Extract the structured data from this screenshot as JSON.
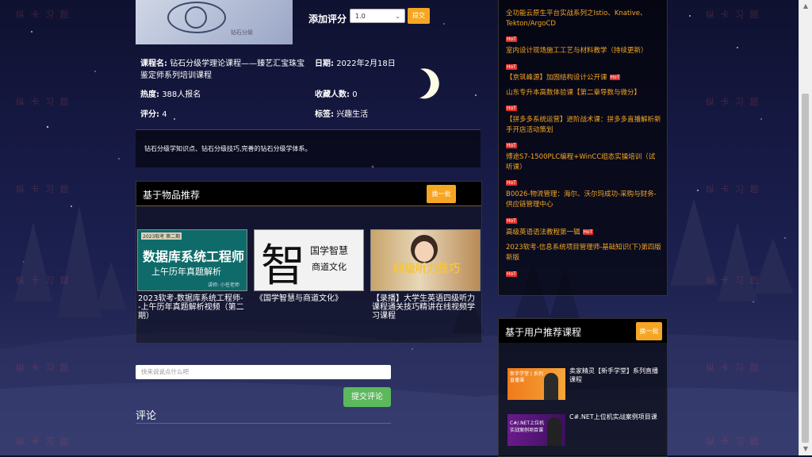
{
  "course": {
    "image_caption": "钻石分级",
    "rate_label": "添加评分",
    "rate_value": "1.0",
    "rate_submit": "提交",
    "name_label": "课程名:",
    "name_value": "钻石分级学理论课程——臻艺汇宝珠宝鉴定师系列培训课程",
    "date_label": "日期:",
    "date_value": "2022年2月18日",
    "heat_label": "热度:",
    "heat_value": "388人报名",
    "fav_label": "收藏人数:",
    "fav_value": "0",
    "score_label": "评分:",
    "score_value": "4",
    "tag_label": "标签:",
    "tag_value": "兴趣生活",
    "description": "钻石分级学知识点、钻石分级技巧,完善的钻石分级学体系。"
  },
  "item_rec": {
    "title": "基于物品推荐",
    "refresh": "换一批",
    "cards": [
      {
        "title": "2023软考-数据库系统工程师--上午历年真题解析视频（第二期）",
        "img_badge": "2023软考 第二期",
        "img_main": "数据库系统工程师",
        "img_sub": "上午历年真题解析",
        "img_teacher": "讲师: 小任老师"
      },
      {
        "title": "《国学智慧与商道文化》",
        "img_big": "智",
        "img_main": "国学智慧",
        "img_sub": "商道文化"
      },
      {
        "title": "【录播】大学生英语四级听力课程通关技巧精讲在线视频学习课程",
        "img_main": "四级听力技巧"
      }
    ]
  },
  "comment": {
    "placeholder": "快来说说点什么吧",
    "submit": "提交评论",
    "title": "评论"
  },
  "hot": {
    "badge": "HoT",
    "items": [
      {
        "text": "全功能云原生平台实战系列之Istio、Knative、Tekton/ArgoCD"
      },
      {
        "text": "室内设计现场施工工艺与材料教学（持续更新）"
      },
      {
        "text": "【京筑峰源】加固结构设计公开课"
      },
      {
        "text": "山东专升本高数体验课【第二章导数与微分】"
      },
      {
        "text": "【拼多多系统运营】进阶战术课：拼多多直播解析新手开店活动策划"
      },
      {
        "text": "博途S7-1500PLC编程+WinCC组态实操培训（试听课）"
      },
      {
        "text": "B0026-物流管理：海尔、沃尔玛成功-采购与财务-供应链管理中心"
      },
      {
        "text": "高级英语语法教程第一辑"
      },
      {
        "text": "2023软考-信息系统项目管理师-基础知识(下)第四版新版"
      }
    ]
  },
  "user_rec": {
    "title": "基于用户推荐课程",
    "refresh": "换一批",
    "cards": [
      {
        "title": "卖家精灵【新手学堂】系列直播课程",
        "img_text": "新手学堂 | 系列直播课"
      },
      {
        "title": "C#.NET上位机实战案例项目课",
        "img_text": "C#/.NET上位机 实战案例项目课"
      }
    ]
  },
  "watermark": "纵 卡 习 题",
  "colors": {
    "accent": "#f5a623",
    "hot_badge": "#e0302a",
    "submit": "#5cb85c"
  }
}
